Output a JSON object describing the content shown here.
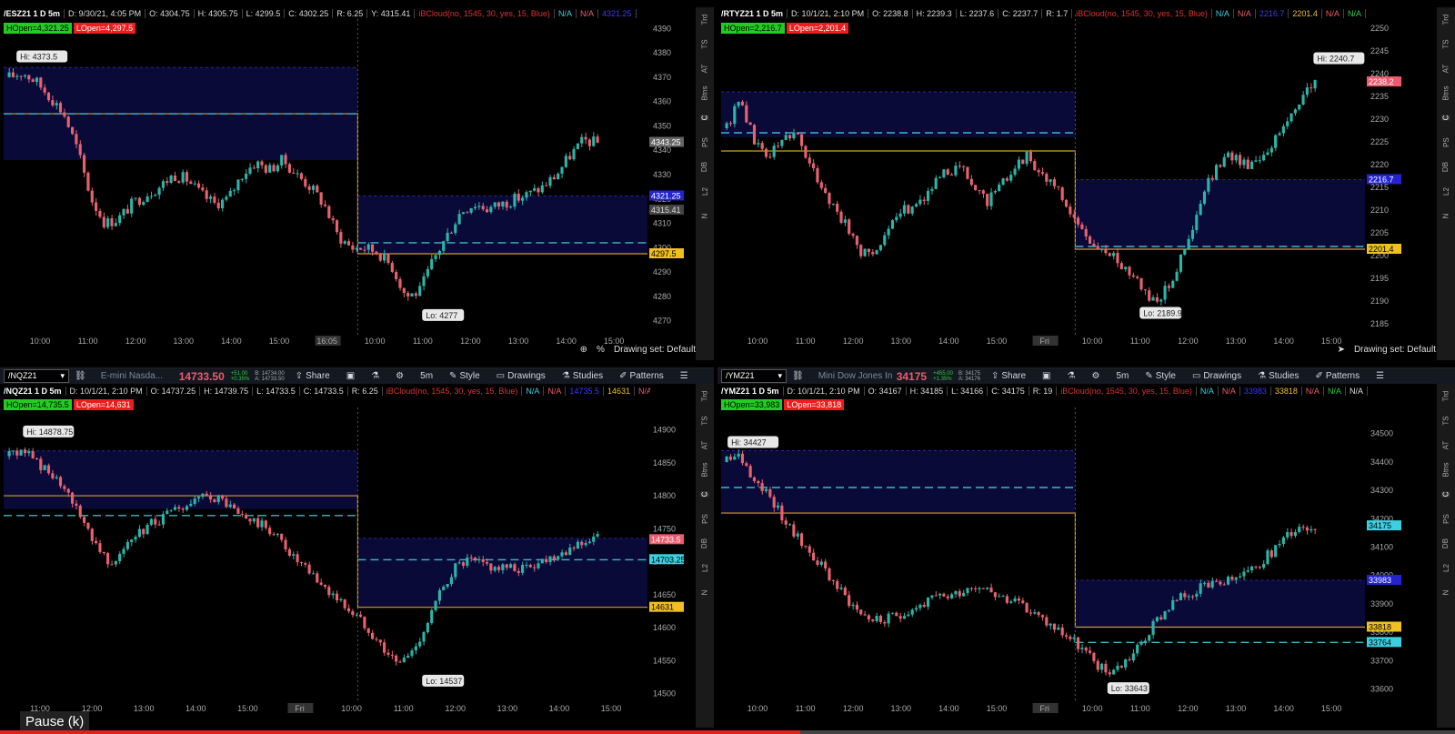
{
  "panes": [
    {
      "id": "es",
      "header": [
        {
          "t": "/ESZ21 1 D 5m",
          "c": "sym"
        },
        {
          "t": "D: 9/30/21, 4:05 PM"
        },
        {
          "t": "O: 4304.75"
        },
        {
          "t": "H: 4305.75"
        },
        {
          "t": "L: 4299.5"
        },
        {
          "t": "C: 4302.25"
        },
        {
          "t": "R: 6.25"
        },
        {
          "t": "Y: 4315.41"
        },
        {
          "t": "iBCloud(no, 1545, 30, yes, 15, Blue)",
          "c": "red"
        },
        {
          "t": "N/A",
          "c": "cyan"
        },
        {
          "t": "N/A",
          "c": "pink"
        },
        {
          "t": "4321.25",
          "c": "blue"
        }
      ],
      "hopen": "HOpen=4,321.25",
      "lopen": "LOpen=4,297.5",
      "hi_label": "Hi: 4373.5",
      "lo_label": "Lo: 4277",
      "xticks": [
        "10:00",
        "11:00",
        "12:00",
        "13:00",
        "14:00",
        "15:00",
        "16:05",
        "10:00",
        "11:00",
        "12:00",
        "13:00",
        "14:00",
        "15:00"
      ],
      "yticks": [
        "4390",
        "4380",
        "4370",
        "4360",
        "4350",
        "4340",
        "4330",
        "4320",
        "4310",
        "4300",
        "4290",
        "4280",
        "4270"
      ],
      "price_tags": [
        {
          "t": "4343.25",
          "bg": "#666",
          "fg": "#fff",
          "y": 4343.25
        },
        {
          "t": "4321.25",
          "bg": "#2323d0",
          "fg": "#fff",
          "y": 4321.25
        },
        {
          "t": "4315.41",
          "bg": "#444",
          "fg": "#ddd",
          "y": 4315.41
        },
        {
          "t": "4297.5",
          "bg": "#f0c020",
          "fg": "#000",
          "y": 4297.5
        }
      ],
      "bottom": "Drawing set: Default"
    },
    {
      "id": "rty",
      "header": [
        {
          "t": "/RTYZ21 1 D 5m",
          "c": "sym"
        },
        {
          "t": "D: 10/1/21, 2:10 PM"
        },
        {
          "t": "O: 2238.8"
        },
        {
          "t": "H: 2239.3"
        },
        {
          "t": "L: 2237.6"
        },
        {
          "t": "C: 2237.7"
        },
        {
          "t": "R: 1.7"
        },
        {
          "t": "iBCloud(no, 1545, 30, yes, 15, Blue)",
          "c": "red"
        },
        {
          "t": "N/A",
          "c": "cyan"
        },
        {
          "t": "N/A",
          "c": "pink"
        },
        {
          "t": "2216.7",
          "c": "blue"
        },
        {
          "t": "2201.4",
          "c": "yel"
        },
        {
          "t": "N/A",
          "c": "pink"
        },
        {
          "t": "N/A",
          "c": "grn"
        }
      ],
      "hopen": "HOpen=2,216.7",
      "lopen": "LOpen=2,201.4",
      "hi_label": "Hi: 2240.7",
      "lo_label": "Lo: 2189.9",
      "xticks": [
        "10:00",
        "11:00",
        "12:00",
        "13:00",
        "14:00",
        "15:00",
        "Fri",
        "10:00",
        "11:00",
        "12:00",
        "13:00",
        "14:00",
        "15:00"
      ],
      "yticks": [
        "2250",
        "2245",
        "2240",
        "2235",
        "2230",
        "2225",
        "2220",
        "2215",
        "2210",
        "2205",
        "2200",
        "2195",
        "2190",
        "2185"
      ],
      "price_tags": [
        {
          "t": "2238.2",
          "bg": "#ef5a6f",
          "fg": "#fff",
          "y": 2238.2
        },
        {
          "t": "2216.7",
          "bg": "#2323d0",
          "fg": "#fff",
          "y": 2216.7
        },
        {
          "t": "2201.4",
          "bg": "#f0c020",
          "fg": "#000",
          "y": 2201.4
        }
      ],
      "bottom": "Drawing set: Default"
    },
    {
      "id": "nq",
      "toolbar": {
        "symbol": "/NQZ21",
        "desc": "E-mini Nasda...",
        "price": "14733.50",
        "chg1": "+51.00",
        "chg2": "+0.35%",
        "ba1": "B: 14734.00",
        "ba2": "A: 14733.50"
      },
      "header": [
        {
          "t": "/NQZ21 1 D 5m",
          "c": "sym"
        },
        {
          "t": "D: 10/1/21, 2:10 PM"
        },
        {
          "t": "O: 14737.25"
        },
        {
          "t": "H: 14739.75"
        },
        {
          "t": "L: 14733.5"
        },
        {
          "t": "C: 14733.5"
        },
        {
          "t": "R: 6.25"
        },
        {
          "t": "iBCloud(no, 1545, 30, yes, 15, Blue)",
          "c": "red"
        },
        {
          "t": "N/A",
          "c": "cyan"
        },
        {
          "t": "N/A",
          "c": "pink"
        },
        {
          "t": "14735.5",
          "c": "blue"
        },
        {
          "t": "14631",
          "c": "yel"
        },
        {
          "t": "N/A",
          "c": "pink"
        }
      ],
      "hopen": "HOpen=14,735.5",
      "lopen": "LOpen=14,631",
      "hi_label": "Hi: 14878.75",
      "lo_label": "Lo: 14537",
      "xticks": [
        "11:00",
        "12:00",
        "13:00",
        "14:00",
        "15:00",
        "Fri",
        "10:00",
        "11:00",
        "12:00",
        "13:00",
        "14:00",
        "15:00"
      ],
      "yticks": [
        "14900",
        "14850",
        "14800",
        "14750",
        "14700",
        "14650",
        "14600",
        "14550",
        "14500"
      ],
      "price_tags": [
        {
          "t": "14733.5",
          "bg": "#ef5a6f",
          "fg": "#fff",
          "y": 14733.5
        },
        {
          "t": "14703.25",
          "bg": "#3ccfe0",
          "fg": "#000",
          "y": 14703.25
        },
        {
          "t": "14631",
          "bg": "#f0c020",
          "fg": "#000",
          "y": 14631
        }
      ]
    },
    {
      "id": "ym",
      "toolbar": {
        "symbol": "/YMZ21",
        "desc": "Mini Dow Jones In...",
        "price": "34175",
        "chg1": "+455.00",
        "chg2": "+1.35%",
        "ba1": "B: 34175",
        "ba2": "A: 34176"
      },
      "header": [
        {
          "t": "/YMZ21 1 D 5m",
          "c": "sym"
        },
        {
          "t": "D: 10/1/21, 2:10 PM"
        },
        {
          "t": "O: 34167"
        },
        {
          "t": "H: 34185"
        },
        {
          "t": "L: 34166"
        },
        {
          "t": "C: 34175"
        },
        {
          "t": "R: 19"
        },
        {
          "t": "iBCloud(no, 1545, 30, yes, 15, Blue)",
          "c": "red"
        },
        {
          "t": "N/A",
          "c": "cyan"
        },
        {
          "t": "N/A",
          "c": "pink"
        },
        {
          "t": "33983",
          "c": "blue"
        },
        {
          "t": "33818",
          "c": "yel"
        },
        {
          "t": "N/A",
          "c": "pink"
        },
        {
          "t": "N/A",
          "c": "grn"
        },
        {
          "t": "N/A"
        }
      ],
      "hopen": "HOpen=33,983",
      "lopen": "LOpen=33,818",
      "hi_label": "Hi: 34427",
      "lo_label": "Lo: 33643",
      "xticks": [
        "10:00",
        "11:00",
        "12:00",
        "13:00",
        "14:00",
        "15:00",
        "Fri",
        "10:00",
        "11:00",
        "12:00",
        "13:00",
        "14:00",
        "15:00"
      ],
      "yticks": [
        "34500",
        "34400",
        "34300",
        "34200",
        "34100",
        "34000",
        "33900",
        "33800",
        "33700",
        "33600"
      ],
      "price_tags": [
        {
          "t": "34175",
          "bg": "#3ccfe0",
          "fg": "#000",
          "y": 34175
        },
        {
          "t": "33983",
          "bg": "#2323d0",
          "fg": "#fff",
          "y": 33983
        },
        {
          "t": "33818",
          "bg": "#f0c020",
          "fg": "#000",
          "y": 33818
        },
        {
          "t": "33764",
          "bg": "#3ccfe0",
          "fg": "#000",
          "y": 33764
        }
      ]
    }
  ],
  "sidebar": [
    "Trd",
    "TS",
    "AT",
    "Btns",
    "C",
    "PS",
    "DB",
    "L2",
    "N"
  ],
  "toolbar_buttons": [
    "Share",
    "5m",
    "Style",
    "Drawings",
    "Studies",
    "Patterns"
  ],
  "pause_label": "Pause (k)",
  "progress_percent": 55,
  "colors": {
    "bull": "#2bb5a8",
    "bear": "#e8626e",
    "cloud": "#0a0a38",
    "yellow": "#d0a020",
    "cyan": "#3cb8c8"
  }
}
